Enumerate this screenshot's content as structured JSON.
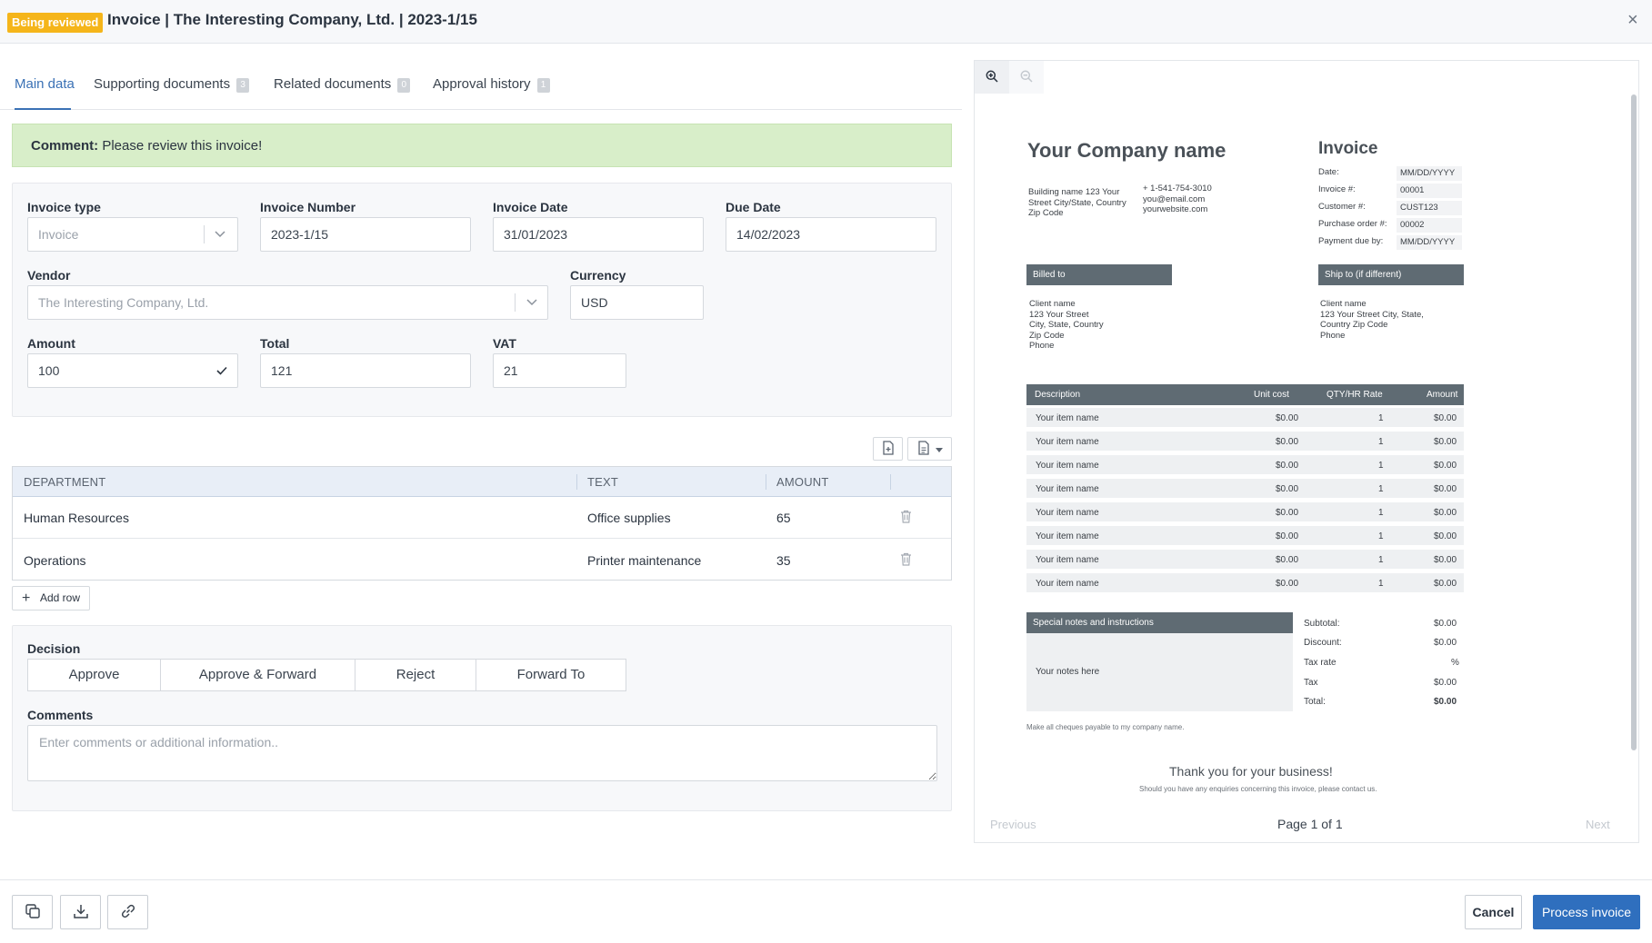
{
  "header": {
    "status_badge": "Being reviewed",
    "title": "Invoice | The Interesting Company, Ltd. | 2023-1/15",
    "close": "×"
  },
  "tabs": [
    {
      "label": "Main data",
      "count": ""
    },
    {
      "label": "Supporting documents",
      "count": "3"
    },
    {
      "label": "Related documents",
      "count": "0"
    },
    {
      "label": "Approval history",
      "count": "1"
    }
  ],
  "comment": {
    "label": "Comment:",
    "text": "Please review this invoice!"
  },
  "form": {
    "invoice_type": {
      "label": "Invoice type",
      "value": "Invoice"
    },
    "invoice_number": {
      "label": "Invoice Number",
      "value": "2023-1/15"
    },
    "invoice_date": {
      "label": "Invoice Date",
      "value": "31/01/2023"
    },
    "due_date": {
      "label": "Due Date",
      "value": "14/02/2023"
    },
    "vendor": {
      "label": "Vendor",
      "value": "The Interesting Company, Ltd."
    },
    "currency": {
      "label": "Currency",
      "value": "USD"
    },
    "amount": {
      "label": "Amount",
      "value": "100"
    },
    "total": {
      "label": "Total",
      "value": "121"
    },
    "vat": {
      "label": "VAT",
      "value": "21"
    }
  },
  "table": {
    "headers": [
      "DEPARTMENT",
      "TEXT",
      "AMOUNT"
    ],
    "rows": [
      {
        "department": "Human Resources",
        "text": "Office supplies",
        "amount": "65"
      },
      {
        "department": "Operations",
        "text": "Printer maintenance",
        "amount": "35"
      }
    ],
    "add_row": "Add row"
  },
  "decision": {
    "label": "Decision",
    "options": [
      "Approve",
      "Approve & Forward",
      "Reject",
      "Forward To"
    ]
  },
  "comments": {
    "label": "Comments",
    "placeholder": "Enter comments or additional information.."
  },
  "footer": {
    "cancel": "Cancel",
    "process": "Process invoice"
  },
  "preview": {
    "company": "Your Company name",
    "invoice_heading": "Invoice",
    "address": [
      "Building name 123 Your",
      "Street City/State, Country",
      "Zip Code"
    ],
    "contact": [
      "+ 1-541-754-3010",
      "you@email.com",
      "yourwebsite.com"
    ],
    "meta": [
      {
        "label": "Date:",
        "value": "MM/DD/YYYY"
      },
      {
        "label": "Invoice #:",
        "value": "00001"
      },
      {
        "label": "Customer #:",
        "value": "CUST123"
      },
      {
        "label": "Purchase order #:",
        "value": "00002"
      },
      {
        "label": "Payment due by:",
        "value": "MM/DD/YYYY"
      }
    ],
    "billed_to": {
      "heading": "Billed to",
      "lines": [
        "Client name",
        "123 Your Street",
        "City, State, Country",
        "Zip Code",
        "Phone"
      ]
    },
    "ship_to": {
      "heading": "Ship to (if different)",
      "lines": [
        "Client name",
        "123 Your Street City, State,",
        "Country Zip Code",
        "Phone"
      ]
    },
    "items_header": [
      "Description",
      "Unit cost",
      "QTY/HR Rate",
      "Amount"
    ],
    "items": [
      {
        "name": "Your item name",
        "unit": "$0.00",
        "qty": "1",
        "amount": "$0.00"
      },
      {
        "name": "Your item name",
        "unit": "$0.00",
        "qty": "1",
        "amount": "$0.00"
      },
      {
        "name": "Your item name",
        "unit": "$0.00",
        "qty": "1",
        "amount": "$0.00"
      },
      {
        "name": "Your item name",
        "unit": "$0.00",
        "qty": "1",
        "amount": "$0.00"
      },
      {
        "name": "Your item name",
        "unit": "$0.00",
        "qty": "1",
        "amount": "$0.00"
      },
      {
        "name": "Your item name",
        "unit": "$0.00",
        "qty": "1",
        "amount": "$0.00"
      },
      {
        "name": "Your item name",
        "unit": "$0.00",
        "qty": "1",
        "amount": "$0.00"
      },
      {
        "name": "Your item name",
        "unit": "$0.00",
        "qty": "1",
        "amount": "$0.00"
      }
    ],
    "notes_heading": "Special  notes  and  instructions",
    "notes_text": "Your notes here",
    "summary": [
      {
        "label": "Subtotal:",
        "value": "$0.00"
      },
      {
        "label": "Discount:",
        "value": "$0.00"
      },
      {
        "label": "Tax rate",
        "value": "%"
      },
      {
        "label": "Tax",
        "value": "$0.00"
      },
      {
        "label": "Total:",
        "value": "$0.00"
      }
    ],
    "cheques_note": "Make all cheques payable to my company name.",
    "thanks": "Thank  you  for  your  business!",
    "enquiries": "Should you have any enquiries concerning this invoice, please contact us.",
    "pager": {
      "previous": "Previous",
      "page": "Page 1 of 1",
      "next": "Next"
    }
  }
}
